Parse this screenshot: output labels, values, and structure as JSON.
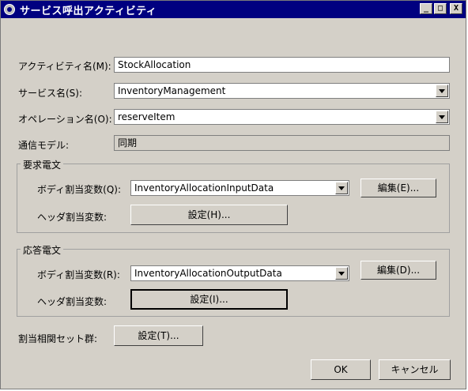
{
  "window": {
    "title": "サービス呼出アクティビティ",
    "controls": {
      "minimize": "_",
      "maximize": "□",
      "close": "X"
    }
  },
  "form": {
    "activity_name_label": "アクティビティ名(M):",
    "activity_name_value": "StockAllocation",
    "service_name_label": "サービス名(S):",
    "service_name_value": "InventoryManagement",
    "operation_name_label": "オペレーション名(O):",
    "operation_name_value": "reserveItem",
    "comm_model_label": "通信モデル:",
    "comm_model_value": "同期"
  },
  "request": {
    "group_title": "要求電文",
    "body_label": "ボディ割当変数(Q):",
    "body_value": "InventoryAllocationInputData",
    "edit_button": "編集(E)...",
    "header_label": "ヘッダ割当変数:",
    "header_button": "設定(H)..."
  },
  "response": {
    "group_title": "応答電文",
    "body_label": "ボディ割当変数(R):",
    "body_value": "InventoryAllocationOutputData",
    "edit_button": "編集(D)...",
    "header_label": "ヘッダ割当変数:",
    "header_button": "設定(I)..."
  },
  "correlation": {
    "label": "割当相関セット群:",
    "button": "設定(T)..."
  },
  "footer": {
    "ok": "OK",
    "cancel": "キャンセル"
  }
}
